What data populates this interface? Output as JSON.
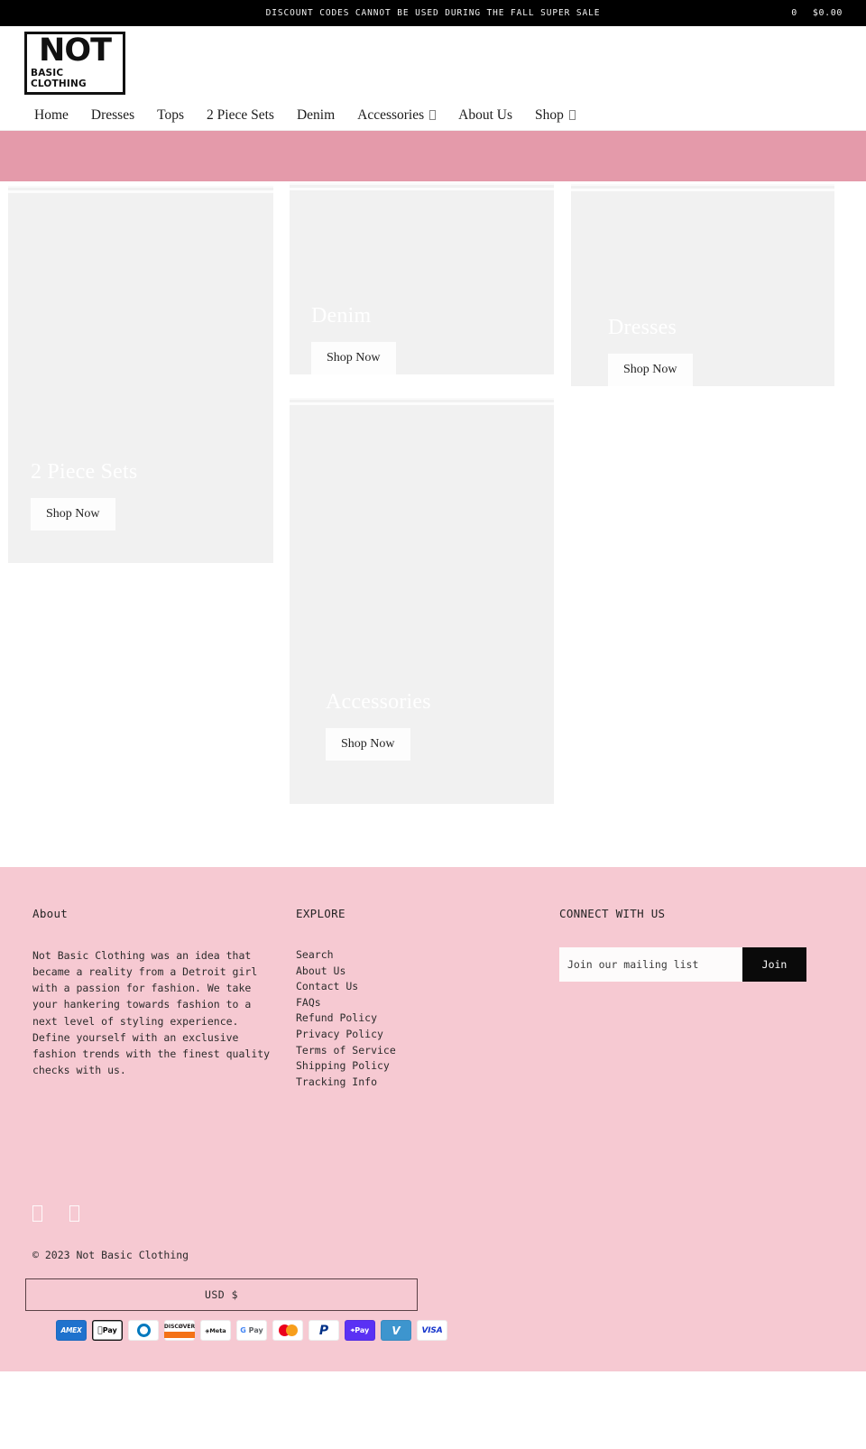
{
  "announcement": {
    "message": "DISCOUNT CODES CANNOT BE USED DURING THE FALL SUPER SALE",
    "cart_count": "0",
    "cart_total": "$0.00"
  },
  "logo": {
    "main": "NOT",
    "sub": "BASIC CLOTHING"
  },
  "nav": {
    "items": [
      {
        "label": "Home",
        "has_dropdown": false
      },
      {
        "label": "Dresses",
        "has_dropdown": false
      },
      {
        "label": "Tops",
        "has_dropdown": false
      },
      {
        "label": "2 Piece Sets",
        "has_dropdown": false
      },
      {
        "label": "Denim",
        "has_dropdown": false
      },
      {
        "label": "Accessories",
        "has_dropdown": true
      },
      {
        "label": "About Us",
        "has_dropdown": false
      },
      {
        "label": "Shop",
        "has_dropdown": true
      }
    ]
  },
  "theme": {
    "banner_pink": "#e49aaa",
    "footer_pink": "#f6c9d2",
    "accent_black": "#000000",
    "card_placeholder": "#f1f1f1"
  },
  "collections": [
    {
      "title": "2 Piece Sets",
      "cta": "Shop Now"
    },
    {
      "title": "Denim",
      "cta": "Shop Now"
    },
    {
      "title": "Dresses",
      "cta": "Shop Now"
    },
    {
      "title": "Accessories",
      "cta": "Shop Now"
    }
  ],
  "footer": {
    "about": {
      "heading": "About",
      "text": "Not Basic Clothing was an idea that became a reality from a Detroit girl with a passion for fashion. We take your hankering towards fashion to a next level of styling experience. Define yourself with an exclusive fashion trends with the finest quality checks with us."
    },
    "explore": {
      "heading": "EXPLORE",
      "links": [
        "Search",
        "About Us",
        "Contact Us",
        "FAQs",
        "Refund Policy",
        "Privacy Policy",
        "Terms of Service",
        "Shipping Policy",
        "Tracking Info"
      ]
    },
    "connect": {
      "heading": "CONNECT WITH US",
      "email_placeholder": "Join our mailing list",
      "email_value": "",
      "join_label": "Join"
    },
    "socials": [
      "facebook-icon",
      "instagram-icon"
    ],
    "copyright": "© 2023 Not Basic Clothing",
    "currency": "USD  $",
    "payments": [
      {
        "name": "american-express",
        "label": "AMEX"
      },
      {
        "name": "apple-pay",
        "label": "Pay"
      },
      {
        "name": "diners-club",
        "label": ""
      },
      {
        "name": "discover",
        "label": "DISCØVER"
      },
      {
        "name": "meta-pay",
        "label": "Meta"
      },
      {
        "name": "google-pay",
        "label": "Pay"
      },
      {
        "name": "mastercard",
        "label": ""
      },
      {
        "name": "paypal",
        "label": "P"
      },
      {
        "name": "shop-pay",
        "label": "Pay"
      },
      {
        "name": "venmo",
        "label": "V"
      },
      {
        "name": "visa",
        "label": "VISA"
      }
    ]
  }
}
